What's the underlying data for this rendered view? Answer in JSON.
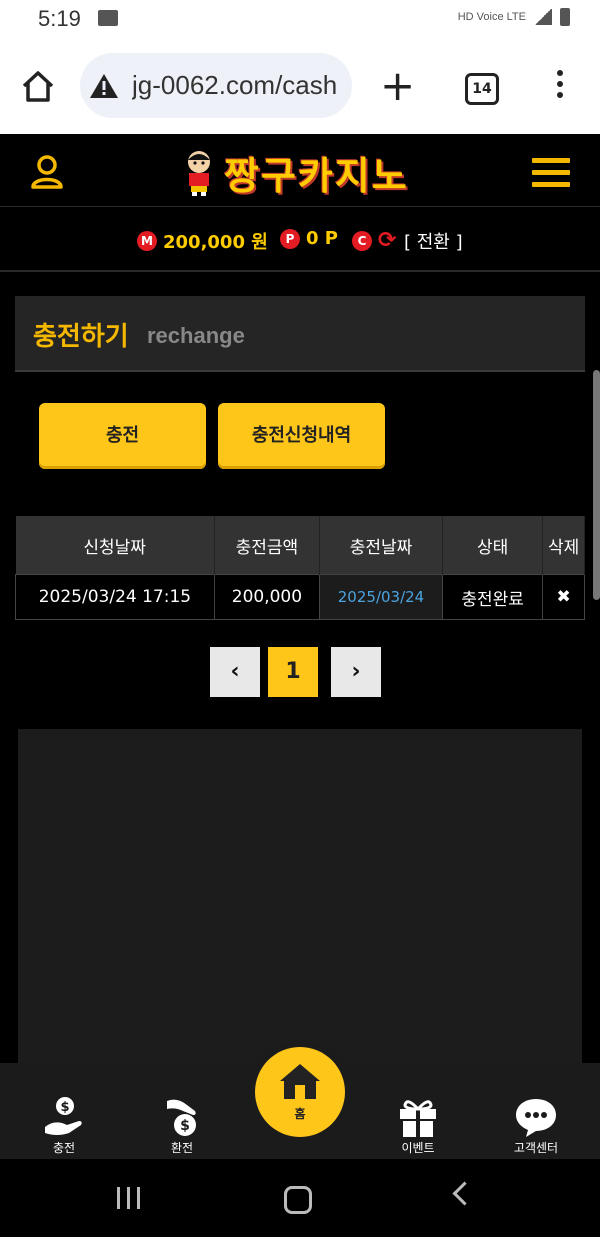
{
  "status_bar": {
    "time": "5:19",
    "indicators": "HD Voice LTE"
  },
  "browser": {
    "url": "jg-0062.com/cash",
    "tab_count": "14"
  },
  "site": {
    "logo_text": "짱구카지노"
  },
  "balance": {
    "money_badge": "M",
    "money": "200,000 원",
    "point_badge": "P",
    "points": "0 P",
    "coupon_badge": "C",
    "convert_label": "[ 전환 ]"
  },
  "section": {
    "title": "충전하기",
    "subtitle": "rechange"
  },
  "buttons": {
    "charge": "충전",
    "history": "충전신청내역"
  },
  "table": {
    "headers": [
      "신청날짜",
      "충전금액",
      "충전날짜",
      "상태",
      "삭제"
    ],
    "rows": [
      {
        "request_date": "2025/03/24 17:15",
        "amount": "200,000",
        "charge_date": "2025/03/24",
        "status": "충전완료",
        "delete": "✖"
      }
    ]
  },
  "pagination": {
    "prev": "‹",
    "current": "1",
    "next": "›"
  },
  "bottom_nav": {
    "charge": "충전",
    "exchange": "환전",
    "home": "홈",
    "event": "이벤트",
    "support": "고객센터"
  },
  "colors": {
    "accent": "#ffc61a",
    "badge_red": "#e31b23",
    "link_blue": "#4aa3df"
  }
}
